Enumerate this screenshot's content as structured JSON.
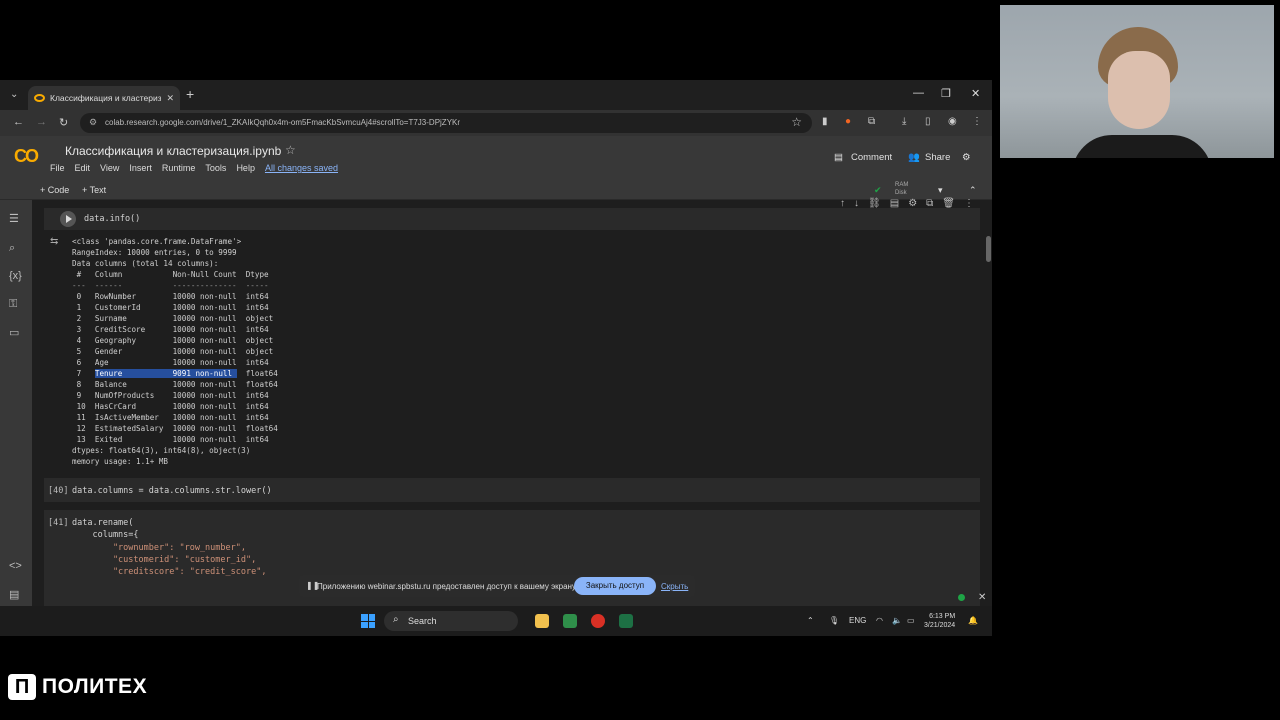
{
  "browser": {
    "tab_title": "Классификация и кластериза",
    "url": "colab.research.google.com/drive/1_ZKAIkQqh0x4m-om5FmacKbSvmcuAj4#scrollTo=T7J3-DPjZYKr"
  },
  "colab": {
    "logo": "CO",
    "notebook_title": "Классификация и кластеризация.ipynb",
    "menu": [
      "File",
      "Edit",
      "View",
      "Insert",
      "Runtime",
      "Tools",
      "Help"
    ],
    "saved_status": "All changes saved",
    "comment_label": "Comment",
    "share_label": "Share",
    "add_code_label": "+ Code",
    "add_text_label": "+ Text",
    "ram_label": "RAM",
    "disk_label": "Disk"
  },
  "cells": {
    "info_code": "data.info()",
    "cell40_exec": "[40]",
    "cell40_code": "data.columns = data.columns.str.lower()",
    "cell41_exec": "[41]",
    "cell41_lines": [
      "data.rename(",
      "    columns={",
      "        \"rownumber\": \"row_number\",",
      "        \"customerid\": \"customer_id\",",
      "        \"creditscore\": \"credit_score\","
    ]
  },
  "output": {
    "class_line": "<class 'pandas.core.frame.DataFrame'>",
    "range_line": "RangeIndex: 10000 entries, 0 to 9999",
    "cols_line": "Data columns (total 14 columns):",
    "header_line": " #   Column           Non-Null Count  Dtype  ",
    "sep_line": "---  ------           --------------  -----  ",
    "rows": [
      {
        "idx": " 0 ",
        "col": "RowNumber      ",
        "count": "10000 non-null",
        "dtype": "int64  "
      },
      {
        "idx": " 1 ",
        "col": "CustomerId     ",
        "count": "10000 non-null",
        "dtype": "int64  "
      },
      {
        "idx": " 2 ",
        "col": "Surname        ",
        "count": "10000 non-null",
        "dtype": "object "
      },
      {
        "idx": " 3 ",
        "col": "CreditScore    ",
        "count": "10000 non-null",
        "dtype": "int64  "
      },
      {
        "idx": " 4 ",
        "col": "Geography      ",
        "count": "10000 non-null",
        "dtype": "object "
      },
      {
        "idx": " 5 ",
        "col": "Gender         ",
        "count": "10000 non-null",
        "dtype": "object "
      },
      {
        "idx": " 6 ",
        "col": "Age            ",
        "count": "10000 non-null",
        "dtype": "int64  "
      },
      {
        "idx": " 7 ",
        "col": "Tenure         ",
        "count": "9091 non-null ",
        "dtype": "float64"
      },
      {
        "idx": " 8 ",
        "col": "Balance        ",
        "count": "10000 non-null",
        "dtype": "float64"
      },
      {
        "idx": " 9 ",
        "col": "NumOfProducts  ",
        "count": "10000 non-null",
        "dtype": "int64  "
      },
      {
        "idx": " 10",
        "col": "HasCrCard      ",
        "count": "10000 non-null",
        "dtype": "int64  "
      },
      {
        "idx": " 11",
        "col": "IsActiveMember ",
        "count": "10000 non-null",
        "dtype": "int64  "
      },
      {
        "idx": " 12",
        "col": "EstimatedSalary",
        "count": "10000 non-null",
        "dtype": "float64"
      },
      {
        "idx": " 13",
        "col": "Exited         ",
        "count": "10000 non-null",
        "dtype": "int64  "
      }
    ],
    "dtypes_line": "dtypes: float64(3), int64(8), object(3)",
    "memory_line": "memory usage: 1.1+ MB"
  },
  "share_banner": {
    "message": "Приложению webinar.spbstu.ru предоставлен доступ к вашему экрану.",
    "stop_label": "Закрыть доступ",
    "hide_label": "Скрыть"
  },
  "taskbar": {
    "search_label": "Search",
    "lang": "ENG",
    "time": "6:13 PM",
    "date": "3/21/2024"
  },
  "brand": {
    "mark": "П",
    "name": "ПОЛИТЕХ"
  }
}
